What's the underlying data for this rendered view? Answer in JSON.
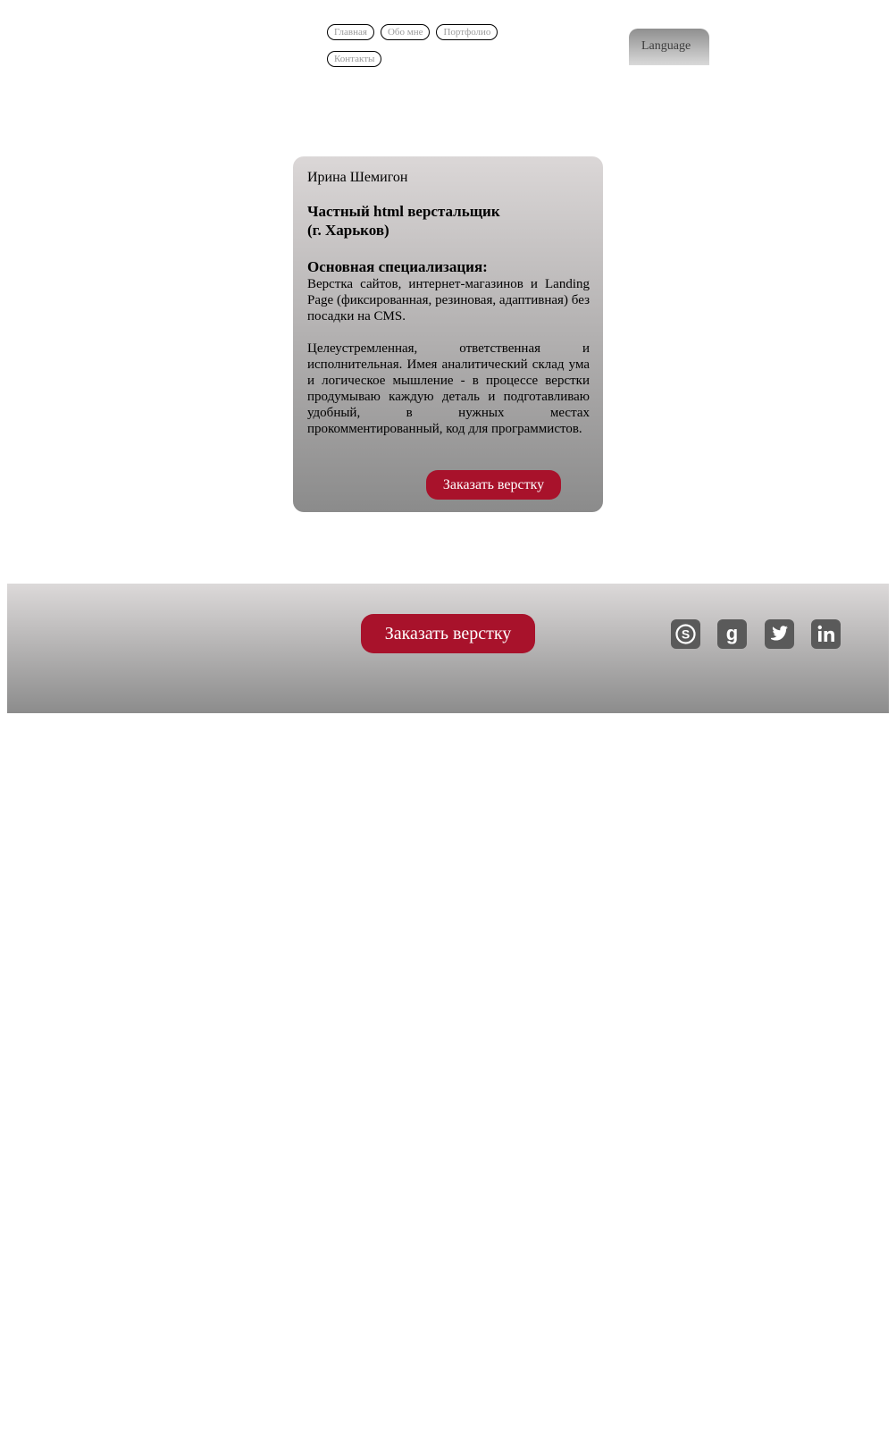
{
  "nav": {
    "items": [
      {
        "label": "Главная"
      },
      {
        "label": "Обо мне"
      },
      {
        "label": "Портфолио"
      },
      {
        "label": "Контакты"
      }
    ]
  },
  "language": {
    "label": "Language"
  },
  "card": {
    "name": "Ирина Шемигон",
    "title_line1": "Частный html верстальщик",
    "title_line2": "(г. Харьков)",
    "spec_heading": "Основная специализация:",
    "spec_text": "Верстка сайтов, интернет-магазинов и Landing Page (фиксированная, резиновая, адаптивная) без посадки на CMS.",
    "about_text": "Целеустремленная, ответственная и исполнительная. Имея аналитический склад ума и логическое мышление - в процессе верстки продумываю каждую деталь и подготавливаю удобный, в нужных местах прокомментированный, код для программистов.",
    "order_button": "Заказать верстку"
  },
  "footer": {
    "order_button": "Заказать верстку",
    "social": [
      {
        "icon": "skype-icon"
      },
      {
        "icon": "google-icon"
      },
      {
        "icon": "twitter-icon"
      },
      {
        "icon": "linkedin-icon"
      }
    ]
  },
  "colors": {
    "accent": "#a8122b",
    "icon": "#5a5a5a"
  }
}
